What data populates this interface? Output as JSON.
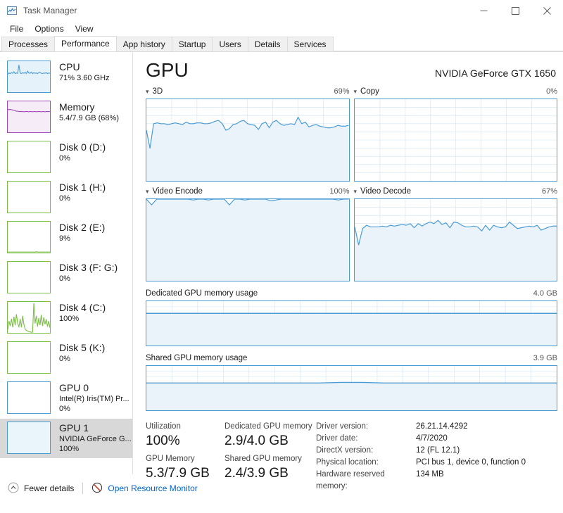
{
  "window": {
    "title": "Task Manager",
    "icon": "task-manager-icon",
    "minimize": "—",
    "maximize": "□",
    "close": "×"
  },
  "menu": {
    "items": [
      "File",
      "Options",
      "View"
    ]
  },
  "tabs": {
    "items": [
      "Processes",
      "Performance",
      "App history",
      "Startup",
      "Users",
      "Details",
      "Services"
    ],
    "active": "Performance"
  },
  "sidebar": {
    "items": [
      {
        "title": "CPU",
        "sub": "71% 3.60 GHz",
        "sub2": "",
        "color": "#4a9bd4",
        "fill": "#e6f2fa",
        "selected": false
      },
      {
        "title": "Memory",
        "sub": "5.4/7.9 GB (68%)",
        "sub2": "",
        "color": "#a347ba",
        "fill": "#f5ecf7",
        "selected": false
      },
      {
        "title": "Disk 0 (D:)",
        "sub": "0%",
        "sub2": "",
        "color": "#79bf43",
        "fill": "#ffffff",
        "selected": false
      },
      {
        "title": "Disk 1 (H:)",
        "sub": "0%",
        "sub2": "",
        "color": "#79bf43",
        "fill": "#ffffff",
        "selected": false
      },
      {
        "title": "Disk 2 (E:)",
        "sub": "9%",
        "sub2": "",
        "color": "#79bf43",
        "fill": "#ffffff",
        "selected": false
      },
      {
        "title": "Disk 3 (F: G:)",
        "sub": "0%",
        "sub2": "",
        "color": "#79bf43",
        "fill": "#ffffff",
        "selected": false
      },
      {
        "title": "Disk 4 (C:)",
        "sub": "100%",
        "sub2": "",
        "color": "#79bf43",
        "fill": "#ffffff",
        "selected": false
      },
      {
        "title": "Disk 5 (K:)",
        "sub": "0%",
        "sub2": "",
        "color": "#79bf43",
        "fill": "#ffffff",
        "selected": false
      },
      {
        "title": "GPU 0",
        "sub": "Intel(R) Iris(TM) Pr...",
        "sub2": "0%",
        "color": "#4a9bd4",
        "fill": "#ffffff",
        "selected": false
      },
      {
        "title": "GPU 1",
        "sub": "NVIDIA GeForce G...",
        "sub2": "100%",
        "color": "#4a9bd4",
        "fill": "#eaf4fb",
        "selected": true
      }
    ]
  },
  "main": {
    "title": "GPU",
    "model": "NVIDIA GeForce GTX 1650",
    "engines": [
      {
        "name": "3D",
        "value": "69%"
      },
      {
        "name": "Copy",
        "value": "0%"
      },
      {
        "name": "Video Encode",
        "value": "100%"
      },
      {
        "name": "Video Decode",
        "value": "67%"
      }
    ],
    "memory_graphs": [
      {
        "name": "Dedicated GPU memory usage",
        "max": "4.0 GB"
      },
      {
        "name": "Shared GPU memory usage",
        "max": "3.9 GB"
      }
    ],
    "stats": {
      "utilization_label": "Utilization",
      "utilization_value": "100%",
      "gpu_memory_label": "GPU Memory",
      "gpu_memory_value": "5.3/7.9 GB",
      "dedicated_label": "Dedicated GPU memory",
      "dedicated_value": "2.9/4.0 GB",
      "shared_label": "Shared GPU memory",
      "shared_value": "2.4/3.9 GB"
    },
    "info": [
      {
        "key": "Driver version:",
        "val": "26.21.14.4292"
      },
      {
        "key": "Driver date:",
        "val": "4/7/2020"
      },
      {
        "key": "DirectX version:",
        "val": "12 (FL 12.1)"
      },
      {
        "key": "Physical location:",
        "val": "PCI bus 1, device 0, function 0"
      },
      {
        "key": "Hardware reserved memory:",
        "val": "134 MB"
      }
    ]
  },
  "footer": {
    "fewer_details": "Fewer details",
    "resource_monitor": "Open Resource Monitor"
  },
  "colors": {
    "accent": "#4a9bd4",
    "link": "#0066cc",
    "grid": "#cfe3f2",
    "fill": "#eaf3fa",
    "memory_purple": "#a347ba",
    "disk_green": "#79bf43"
  },
  "chart_data": [
    {
      "type": "line",
      "title": "3D",
      "ylabel": "Utilization %",
      "ylim": [
        0,
        100
      ],
      "label_value": "69%",
      "values": [
        62,
        40,
        70,
        71,
        70,
        70,
        69,
        70,
        71,
        70,
        69,
        72,
        70,
        70,
        71,
        71,
        70,
        70,
        71,
        73,
        74,
        70,
        62,
        64,
        69,
        70,
        73,
        74,
        70,
        69,
        68,
        63,
        70,
        72,
        65,
        72,
        74,
        70,
        68,
        69,
        70,
        69,
        78,
        70,
        72,
        66,
        68,
        69,
        67,
        66,
        65,
        65,
        66,
        68,
        67,
        67,
        68
      ]
    },
    {
      "type": "line",
      "title": "Copy",
      "ylabel": "Utilization %",
      "ylim": [
        0,
        100
      ],
      "label_value": "0%",
      "values": [
        0,
        0,
        0,
        0,
        0,
        0,
        0,
        0,
        0,
        0,
        0,
        0,
        0,
        0,
        0,
        0,
        0,
        0,
        0,
        0,
        0,
        0,
        0,
        0,
        0,
        0,
        0,
        0,
        0,
        0,
        0,
        0,
        0,
        0,
        0,
        0,
        0,
        0,
        0,
        0
      ]
    },
    {
      "type": "line",
      "title": "Video Encode",
      "ylabel": "Utilization %",
      "ylim": [
        0,
        100
      ],
      "label_value": "100%",
      "values": [
        100,
        93,
        100,
        100,
        100,
        100,
        100,
        100,
        100,
        99,
        100,
        100,
        99,
        100,
        100,
        100,
        93,
        100,
        100,
        99,
        100,
        100,
        100,
        100,
        98,
        99,
        100,
        100,
        100,
        100,
        100,
        100,
        100,
        100,
        100,
        100,
        100,
        99,
        100,
        100
      ]
    },
    {
      "type": "line",
      "title": "Video Decode",
      "ylabel": "Utilization %",
      "ylim": [
        0,
        100
      ],
      "label_value": "67%",
      "values": [
        66,
        44,
        64,
        68,
        66,
        66,
        66,
        67,
        66,
        68,
        67,
        68,
        69,
        68,
        70,
        65,
        70,
        67,
        70,
        72,
        70,
        74,
        69,
        71,
        65,
        72,
        71,
        68,
        66,
        66,
        67,
        66,
        61,
        68,
        62,
        68,
        66,
        65,
        66,
        72,
        68,
        64,
        65,
        66,
        67,
        66,
        68,
        62,
        64,
        66,
        67,
        67
      ]
    },
    {
      "type": "area",
      "title": "Dedicated GPU memory usage",
      "ylabel": "GB",
      "ylim": [
        0,
        4.0
      ],
      "max_label": "4.0 GB",
      "values": [
        2.9,
        2.9,
        2.9,
        2.9,
        2.9,
        2.9,
        2.9,
        2.9,
        2.9,
        2.9,
        2.9,
        2.9,
        2.9,
        2.9,
        2.9,
        2.9,
        2.9,
        2.9,
        2.9,
        2.9
      ]
    },
    {
      "type": "area",
      "title": "Shared GPU memory usage",
      "ylabel": "GB",
      "ylim": [
        0,
        3.9
      ],
      "max_label": "3.9 GB",
      "values": [
        2.4,
        2.4,
        2.4,
        2.4,
        2.4,
        2.4,
        2.4,
        2.4,
        2.4,
        2.45,
        2.45,
        2.4,
        2.4,
        2.4,
        2.4,
        2.4,
        2.4,
        2.4,
        2.4,
        2.4
      ]
    }
  ]
}
